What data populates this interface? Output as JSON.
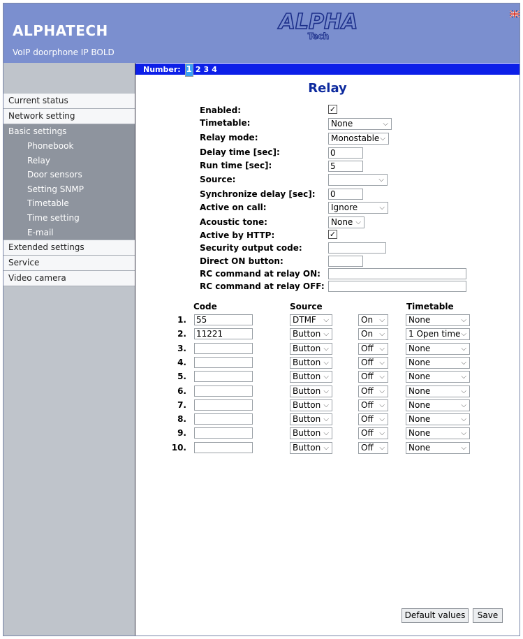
{
  "header": {
    "brand": "ALPHATECH",
    "subtitle": "VoIP doorphone IP BOLD",
    "logo_text": "ALPHA",
    "logo_sub": "Tech"
  },
  "sidebar": {
    "items": [
      {
        "label": "Current status"
      },
      {
        "label": "Network setting"
      }
    ],
    "group": {
      "label": "Basic settings",
      "items": [
        "Phonebook",
        "Relay",
        "Door sensors",
        "Setting SNMP",
        "Timetable",
        "Time setting",
        "E-mail"
      ]
    },
    "items_after": [
      {
        "label": "Extended settings"
      },
      {
        "label": "Service"
      },
      {
        "label": "Video camera"
      }
    ]
  },
  "number_bar": {
    "label": "Number:",
    "numbers": [
      "1",
      "2",
      "3",
      "4"
    ],
    "selected": "1"
  },
  "title": "Relay",
  "form": {
    "enabled": {
      "label": "Enabled:",
      "checked": true
    },
    "timetable": {
      "label": "Timetable:",
      "value": "None"
    },
    "relay_mode": {
      "label": "Relay mode:",
      "value": "Monostable"
    },
    "delay_time": {
      "label": "Delay time [sec]:",
      "value": "0"
    },
    "run_time": {
      "label": "Run time [sec]:",
      "value": "5"
    },
    "source": {
      "label": "Source:",
      "value": ""
    },
    "sync_delay": {
      "label": "Synchronize delay [sec]:",
      "value": "0"
    },
    "active_on_call": {
      "label": "Active on call:",
      "value": "Ignore"
    },
    "acoustic_tone": {
      "label": "Acoustic tone:",
      "value": "None"
    },
    "active_by_http": {
      "label": "Active by HTTP:",
      "checked": true
    },
    "security_code": {
      "label": "Security output code:",
      "value": ""
    },
    "direct_on": {
      "label": "Direct ON button:",
      "value": ""
    },
    "rc_on": {
      "label": "RC command at relay ON:",
      "value": ""
    },
    "rc_off": {
      "label": "RC command at relay OFF:",
      "value": ""
    }
  },
  "codes": {
    "headers": {
      "code": "Code",
      "source": "Source",
      "timetable": "Timetable"
    },
    "rows": [
      {
        "n": "1.",
        "code": "55",
        "source": "DTMF",
        "state": "On",
        "timetable": "None"
      },
      {
        "n": "2.",
        "code": "11221",
        "source": "Button",
        "state": "On",
        "timetable": "1 Open time"
      },
      {
        "n": "3.",
        "code": "",
        "source": "Button",
        "state": "Off",
        "timetable": "None"
      },
      {
        "n": "4.",
        "code": "",
        "source": "Button",
        "state": "Off",
        "timetable": "None"
      },
      {
        "n": "5.",
        "code": "",
        "source": "Button",
        "state": "Off",
        "timetable": "None"
      },
      {
        "n": "6.",
        "code": "",
        "source": "Button",
        "state": "Off",
        "timetable": "None"
      },
      {
        "n": "7.",
        "code": "",
        "source": "Button",
        "state": "Off",
        "timetable": "None"
      },
      {
        "n": "8.",
        "code": "",
        "source": "Button",
        "state": "Off",
        "timetable": "None"
      },
      {
        "n": "9.",
        "code": "",
        "source": "Button",
        "state": "Off",
        "timetable": "None"
      },
      {
        "n": "10.",
        "code": "",
        "source": "Button",
        "state": "Off",
        "timetable": "None"
      }
    ]
  },
  "buttons": {
    "default_values": "Default values",
    "save": "Save"
  },
  "colors": {
    "header_bg": "#7b8fcf",
    "numbar_bg": "#0c1fe8",
    "title": "#0d2a9e",
    "sidebar_bg": "#bfc4cb"
  }
}
